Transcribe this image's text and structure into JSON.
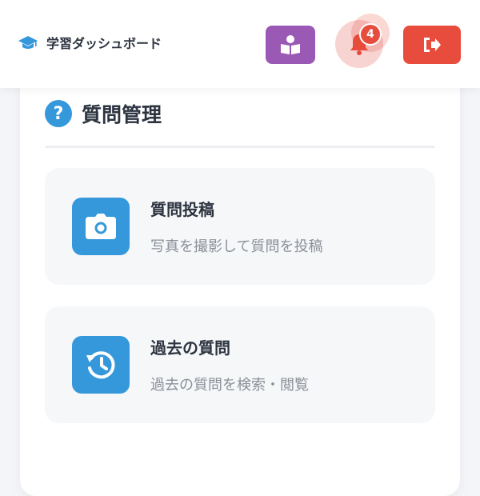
{
  "header": {
    "brand_icon": "graduation-cap-icon",
    "brand_title": "学習ダッシュボード",
    "read_button_icon": "book-reader-icon",
    "notification_icon": "bell-icon",
    "notification_count": "4",
    "logout_icon": "sign-out-icon"
  },
  "section": {
    "icon": "question-circle-icon",
    "icon_glyph": "?",
    "title": "質問管理"
  },
  "cards": [
    {
      "icon": "camera-icon",
      "title": "質問投稿",
      "description": "写真を撮影して質問を投稿"
    },
    {
      "icon": "history-icon",
      "title": "過去の質問",
      "description": "過去の質問を検索・閲覧"
    }
  ],
  "colors": {
    "accent_blue": "#3498db",
    "purple": "#9b59b6",
    "red": "#e74c3c",
    "text_dark": "#2c3440",
    "text_muted": "#8a9099"
  }
}
